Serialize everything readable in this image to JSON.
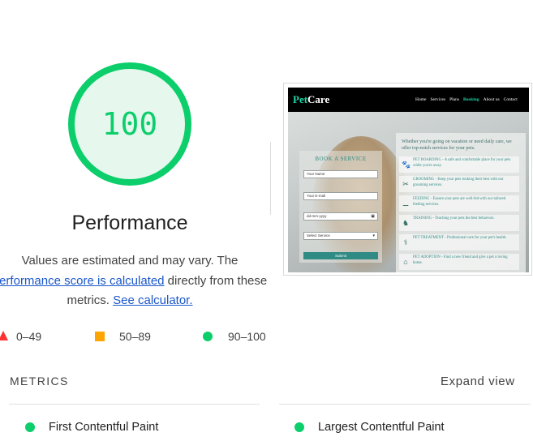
{
  "gauge": {
    "score": "100",
    "title": "Performance",
    "color": "#0cce6b"
  },
  "description": {
    "text1": "Values are estimated and may vary. The",
    "link1": "performance score is calculated",
    "text2": " directly from these metrics. ",
    "link2": "See calculator."
  },
  "legend": {
    "fail": "0–49",
    "average": "50–89",
    "pass": "90–100"
  },
  "screenshot": {
    "logo_pet": "Pet",
    "logo_care": "Care",
    "nav_links": [
      "Home",
      "Services",
      "Plans",
      "Booking",
      "About us",
      "Contact"
    ],
    "active_nav": "Booking",
    "form": {
      "title": "BOOK A SERVICE",
      "name_placeholder": "Your Name",
      "email_placeholder": "Your E-mail",
      "date_placeholder": "dd-mm-yyyy",
      "select_value": "Select Service",
      "submit_label": "Submit"
    },
    "services_intro": "Whether you're going on vacation or need daily care, we offer top-notch services for your pets.",
    "services": [
      {
        "icon": "paw-icon",
        "text": "PET BOARDING - A safe and comfortable place for your pets while you're away."
      },
      {
        "icon": "scissors-icon",
        "text": "GROOMING - Keep your pets looking their best with our grooming services."
      },
      {
        "icon": "bone-icon",
        "text": "FEEDING - Ensure your pets are well-fed with our tailored feeding services."
      },
      {
        "icon": "dog-icon",
        "text": "TRAINING - Teaching your pets the best behaviors."
      },
      {
        "icon": "stethoscope-icon",
        "text": "PET TREATMENT - Professional care for your pet's health."
      },
      {
        "icon": "home-icon",
        "text": "PET ADOPTION - Find a new friend and give a pet a loving home."
      }
    ]
  },
  "metrics": {
    "label": "METRICS",
    "expand": "Expand view",
    "items": [
      "First Contentful Paint",
      "Largest Contentful Paint"
    ]
  }
}
